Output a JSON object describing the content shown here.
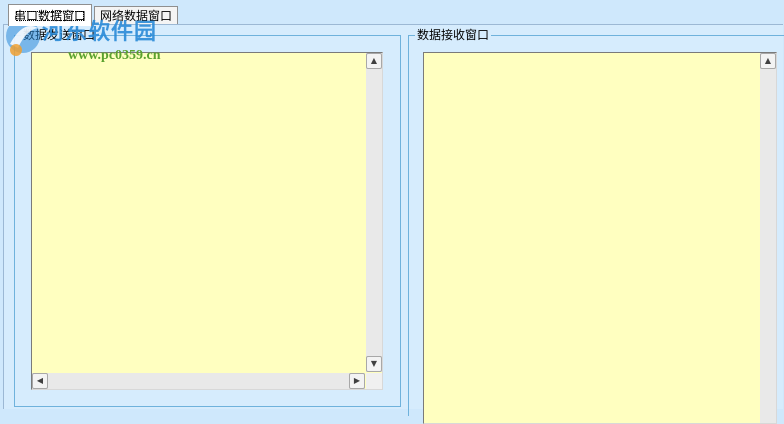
{
  "tabs": [
    {
      "label": "串口数据窗口",
      "active": true
    },
    {
      "label": "网络数据窗口",
      "active": false
    }
  ],
  "send_panel": {
    "title": "数据发送窗口",
    "value": ""
  },
  "receive_panel": {
    "title": "数据接收窗口",
    "value": ""
  },
  "watermark": {
    "title": "河东软件园",
    "url": "www.pc0359.cn"
  },
  "icons": {
    "scroll_up": "▲",
    "scroll_down": "▼",
    "scroll_left": "◀",
    "scroll_right": "▶"
  },
  "colors": {
    "background": "#cfe8fc",
    "textbox": "#ffffc0",
    "groupbox_border": "#6fb2dc",
    "watermark_blue": "#2b8bd8",
    "watermark_green": "#5aa12e"
  }
}
